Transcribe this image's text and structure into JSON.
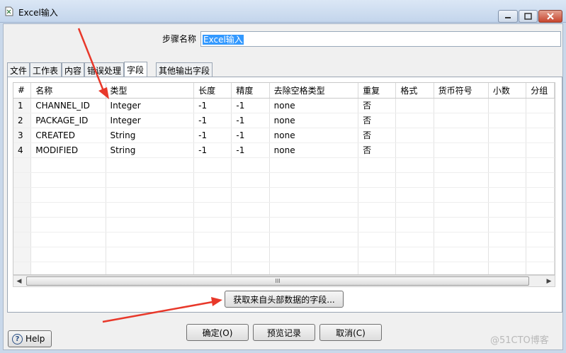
{
  "window": {
    "title": "Excel输入"
  },
  "step": {
    "label": "步骤名称",
    "value": "Excel输入"
  },
  "tabs": [
    {
      "label": "文件"
    },
    {
      "label": "工作表"
    },
    {
      "label": "内容"
    },
    {
      "label": "错误处理"
    },
    {
      "label": "字段",
      "active": true
    },
    {
      "label": "其他输出字段"
    }
  ],
  "table": {
    "columns": [
      "#",
      "名称",
      "类型",
      "长度",
      "精度",
      "去除空格类型",
      "重复",
      "格式",
      "货币符号",
      "小数",
      "分组"
    ],
    "rows": [
      [
        "1",
        "CHANNEL_ID",
        "Integer",
        "-1",
        "-1",
        "none",
        "否"
      ],
      [
        "2",
        "PACKAGE_ID",
        "Integer",
        "-1",
        "-1",
        "none",
        "否"
      ],
      [
        "3",
        "CREATED",
        "String",
        "-1",
        "-1",
        "none",
        "否"
      ],
      [
        "4",
        "MODIFIED",
        "String",
        "-1",
        "-1",
        "none",
        "否"
      ]
    ]
  },
  "buttons": {
    "get_fields": "获取来自头部数据的字段...",
    "ok": "确定(O)",
    "preview": "预览记录",
    "cancel": "取消(C)",
    "help": "Help"
  },
  "scrollbar": {
    "grip": "III"
  },
  "watermark": "@51CTO博客",
  "colors": {
    "annotation_arrow": "#e8382a",
    "selection": "#3399ff"
  }
}
